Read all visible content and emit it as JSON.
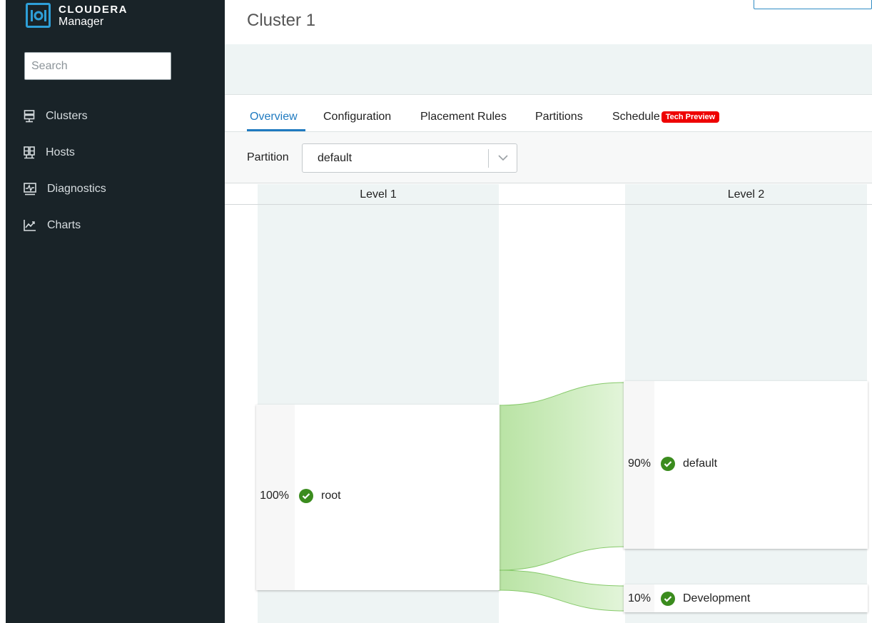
{
  "brand": {
    "title": "CLOUDERA",
    "subtitle": "Manager"
  },
  "search": {
    "placeholder": "Search"
  },
  "nav": [
    {
      "label": "Clusters",
      "icon": "server-icon"
    },
    {
      "label": "Hosts",
      "icon": "hosts-icon"
    },
    {
      "label": "Diagnostics",
      "icon": "pulse-icon"
    },
    {
      "label": "Charts",
      "icon": "line-chart-icon"
    }
  ],
  "page": {
    "title": "Cluster 1"
  },
  "tabs": [
    {
      "label": "Overview",
      "active": true
    },
    {
      "label": "Configuration"
    },
    {
      "label": "Placement Rules"
    },
    {
      "label": "Partitions"
    },
    {
      "label": "Schedule",
      "badge": "Tech Preview"
    }
  ],
  "partition": {
    "label": "Partition",
    "value": "default"
  },
  "levels": {
    "level1": "Level 1",
    "level2": "Level 2"
  },
  "queues": {
    "root": {
      "percent": "100%",
      "name": "root"
    },
    "default": {
      "percent": "90%",
      "name": "default"
    },
    "development": {
      "percent": "10%",
      "name": "Development"
    }
  },
  "colors": {
    "sidebar": "#192328",
    "accent": "#1f7ac0",
    "badge": "#ee0000",
    "ok": "#3b8c1e",
    "flow": "#b9e3a4"
  }
}
